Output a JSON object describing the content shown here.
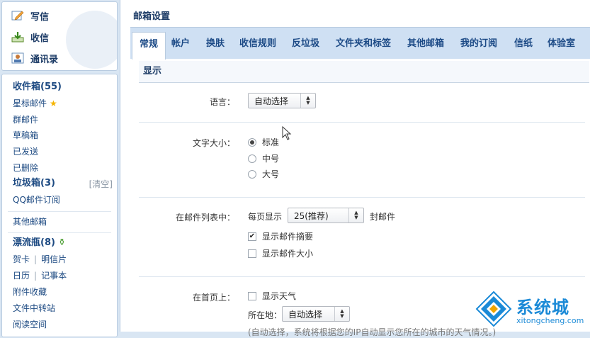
{
  "sidebar": {
    "compose": [
      {
        "label": "写信",
        "icon": "pencil-icon"
      },
      {
        "label": "收信",
        "icon": "download-icon"
      },
      {
        "label": "通讯录",
        "icon": "contacts-icon"
      }
    ],
    "inbox": "收件箱(55)",
    "starred": "星标邮件",
    "group": "群邮件",
    "drafts": "草稿箱",
    "sent": "已发送",
    "deleted": "已删除",
    "spam": "垃圾箱(3)",
    "spam_clear": "[清空]",
    "qq_sub": "QQ邮件订阅",
    "other": "其他邮箱",
    "bottle": "漂流瓶(8)",
    "card": "贺卡",
    "postcard": "明信片",
    "calendar": "日历",
    "notes": "记事本",
    "attachments": "附件收藏",
    "transfer": "文件中转站",
    "reading": "阅读空间"
  },
  "main": {
    "title": "邮箱设置",
    "tabs": [
      "常规",
      "帐户",
      "换肤",
      "收信规则",
      "反垃圾",
      "文件夹和标签",
      "其他邮箱",
      "我的订阅",
      "信纸",
      "体验室"
    ],
    "active_tab": "常规",
    "section": "显示",
    "language": {
      "label": "语言：",
      "value": "自动选择"
    },
    "font_size": {
      "label": "文字大小：",
      "options": [
        "标准",
        "中号",
        "大号"
      ],
      "selected": "标准"
    },
    "mail_list": {
      "label": "在邮件列表中：",
      "per_page_prefix": "每页显示",
      "per_page_value": "25(推荐)",
      "per_page_suffix": "封邮件",
      "show_summary": "显示邮件摘要",
      "show_size": "显示邮件大小"
    },
    "homepage": {
      "label": "在首页上：",
      "show_weather": "显示天气",
      "location_label": "所在地：",
      "location_value": "自动选择",
      "note": "(自动选择，系统将根据您的IP自动显示您所在的城市的天气情况。)"
    }
  },
  "watermark": {
    "text": "系统城",
    "url": "xitongcheng.com"
  },
  "colors": {
    "accent": "#1c4a86",
    "tab_bar": "#cfe0f3",
    "page_bg": "#d9e6f3",
    "watermark": "#1b8ad7"
  }
}
